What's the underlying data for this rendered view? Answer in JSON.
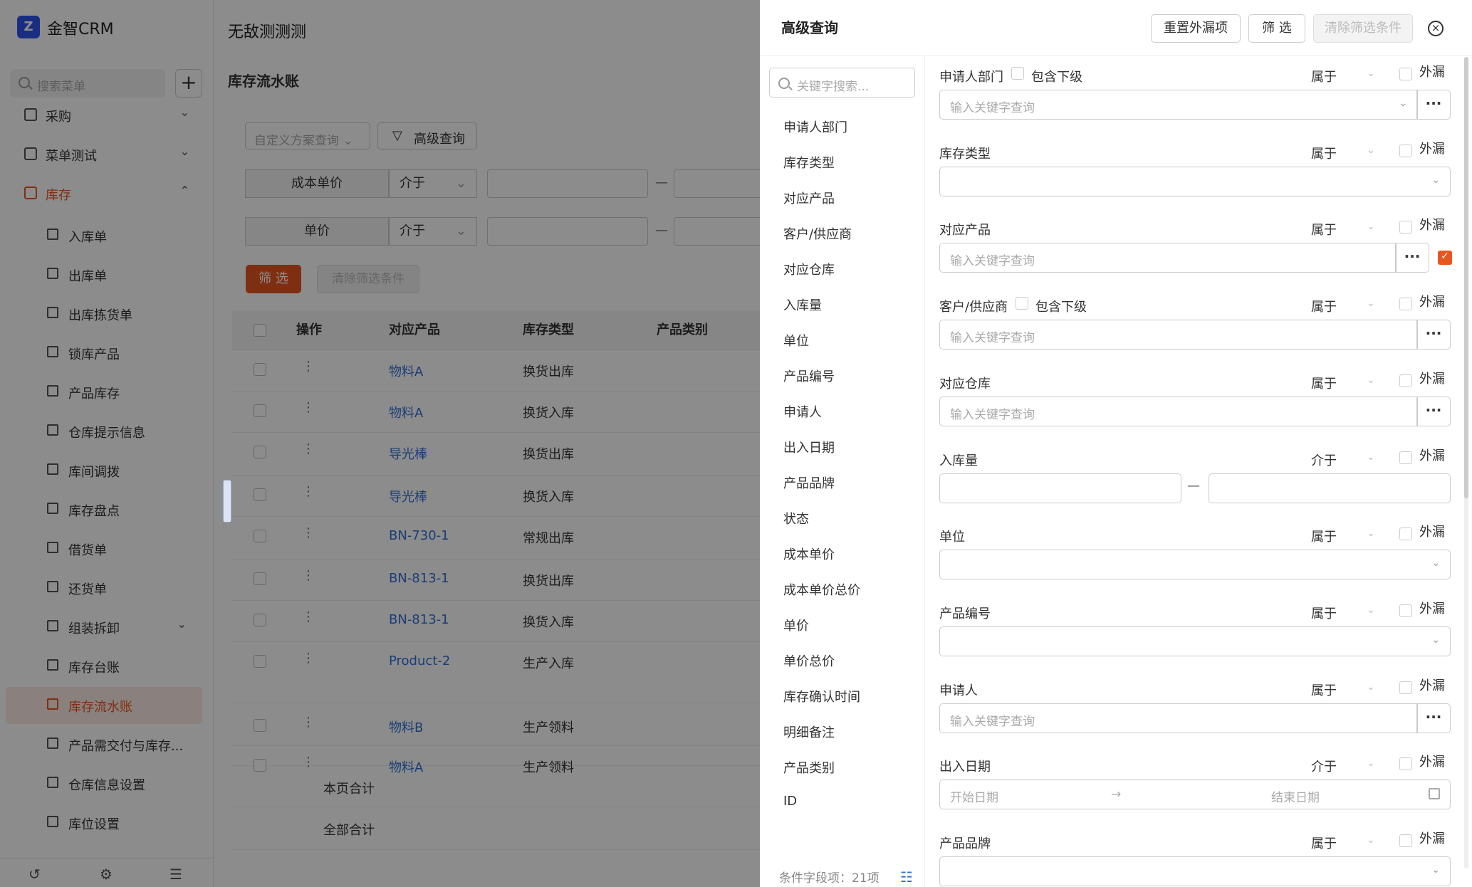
{
  "app": {
    "brand": "金智CRM",
    "logo_glyph": "Z"
  },
  "sidebar": {
    "search_placeholder": "搜索菜单",
    "plus": "+",
    "top_items": [
      {
        "label": "采购",
        "chevron": "⌄"
      },
      {
        "label": "菜单测试",
        "chevron": "⌄"
      },
      {
        "label": "库存",
        "chevron": "⌃"
      }
    ],
    "sub_items": [
      "入库单",
      "出库单",
      "出库拣货单",
      "锁库产品",
      "产品库存",
      "仓库提示信息",
      "库间调拨",
      "库存盘点",
      "借货单",
      "还货单",
      "组装拆卸",
      "库存台账",
      "库存流水账",
      "产品需交付与库存...",
      "仓库信息设置",
      "库位设置"
    ],
    "sub_chevron": "⌄",
    "bottom_icons": [
      "history-icon",
      "sliders-icon",
      "menu-collapse-icon"
    ],
    "bottom_glyphs": [
      "↺",
      "⚙",
      "☰"
    ]
  },
  "main": {
    "page_title": "无敌测测测",
    "breadcrumb": "库存流水账",
    "scheme_select": "自定义方案查询",
    "advanced_button": "高级查询",
    "filters": [
      {
        "label": "成本单价",
        "op": "介于"
      },
      {
        "label": "单价",
        "op": "介于"
      }
    ],
    "filter_button": "筛 选",
    "clear_button": "清除筛选条件",
    "table": {
      "headers": [
        "操作",
        "对应产品",
        "库存类型",
        "产品类别"
      ],
      "rows": [
        {
          "product": "物料A",
          "type": "换货出库"
        },
        {
          "product": "物料A",
          "type": "换货入库"
        },
        {
          "product": "导光棒",
          "type": "换货出库"
        },
        {
          "product": "导光棒",
          "type": "换货入库"
        },
        {
          "product": "BN-730-1",
          "type": "常规出库"
        },
        {
          "product": "BN-813-1",
          "type": "换货出库"
        },
        {
          "product": "BN-813-1",
          "type": "换货入库"
        },
        {
          "product": "Product-2",
          "type": "生产入库"
        },
        {
          "product": "物料B",
          "type": "生产领料"
        },
        {
          "product": "物料A",
          "type": "生产领料"
        }
      ],
      "page_total": "本页合计",
      "grand_total": "全部合计",
      "row_menu": "⋮"
    }
  },
  "drawer": {
    "title": "高级查询",
    "reset_button": "重置外漏项",
    "filter_button": "筛 选",
    "clear_button": "清除筛选条件",
    "close_glyph": "×",
    "keyword_placeholder": "关键字搜索...",
    "fields": [
      "申请人部门",
      "库存类型",
      "对应产品",
      "客户/供应商",
      "对应仓库",
      "入库量",
      "单位",
      "产品编号",
      "申请人",
      "出入日期",
      "产品品牌",
      "状态",
      "成本单价",
      "成本单价总价",
      "单价",
      "单价总价",
      "库存确认时间",
      "明细备注",
      "产品类别",
      "ID"
    ],
    "footer": "条件字段项：21项",
    "include_sub": "包含下级",
    "exposed": "外漏",
    "keyword_input": "输入关键字查询",
    "more": "···",
    "range_dash": "—",
    "date_start": "开始日期",
    "date_arrow": "→",
    "date_end": "结束日期",
    "chevron": "⌄",
    "check": "✓",
    "conditions": [
      {
        "name": "申请人部门",
        "op": "属于"
      },
      {
        "name": "库存类型",
        "op": "属于"
      },
      {
        "name": "对应产品",
        "op": "属于"
      },
      {
        "name": "客户/供应商",
        "op": "属于"
      },
      {
        "name": "对应仓库",
        "op": "属于"
      },
      {
        "name": "入库量",
        "op": "介于"
      },
      {
        "name": "单位",
        "op": "属于"
      },
      {
        "name": "产品编号",
        "op": "属于"
      },
      {
        "name": "申请人",
        "op": "属于"
      },
      {
        "name": "出入日期",
        "op": "介于"
      },
      {
        "name": "产品品牌",
        "op": "属于"
      }
    ]
  },
  "colors": {
    "accent": "#e8561f",
    "link": "#2f6fd8",
    "brand": "#2f54eb"
  }
}
